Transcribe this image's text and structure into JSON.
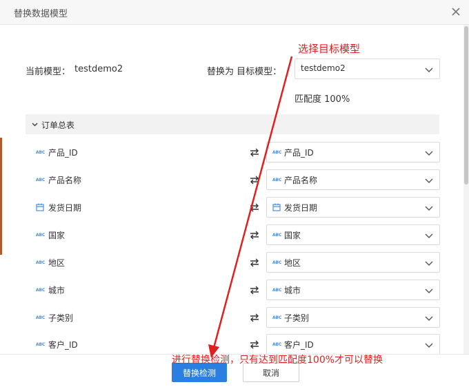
{
  "dialog": {
    "title": "替换数据模型",
    "current_model_label": "当前模型：",
    "current_model_value": "testdemo2",
    "replace_label": "替换为 目标模型：",
    "target_model_value": "testdemo2",
    "match_text": "匹配度 100%"
  },
  "group": {
    "title": "订单总表"
  },
  "fields": [
    {
      "name": "产品_ID",
      "type": "text",
      "target": "产品_ID"
    },
    {
      "name": "产品名称",
      "type": "text",
      "target": "产品名称"
    },
    {
      "name": "发货日期",
      "type": "date",
      "target": "发货日期"
    },
    {
      "name": "国家",
      "type": "text",
      "target": "国家"
    },
    {
      "name": "地区",
      "type": "text",
      "target": "地区"
    },
    {
      "name": "城市",
      "type": "text",
      "target": "城市"
    },
    {
      "name": "子类别",
      "type": "text",
      "target": "子类别"
    },
    {
      "name": "客户_ID",
      "type": "text",
      "target": "客户_ID"
    }
  ],
  "icons": {
    "text_type": "ABC",
    "close": "close-icon",
    "chevron": "chevron-down-icon",
    "swap": "swap-arrows-icon",
    "calendar": "calendar-icon"
  },
  "buttons": {
    "check_label": "替换检测",
    "cancel_label": "取消"
  },
  "annotations": {
    "top": "选择目标模型",
    "bottom": "进行替换检测，只有达到匹配度100%才可以替换"
  },
  "colors": {
    "primary": "#2b7fe0",
    "annotation": "#e02020",
    "type_icon": "#4a90e2"
  }
}
